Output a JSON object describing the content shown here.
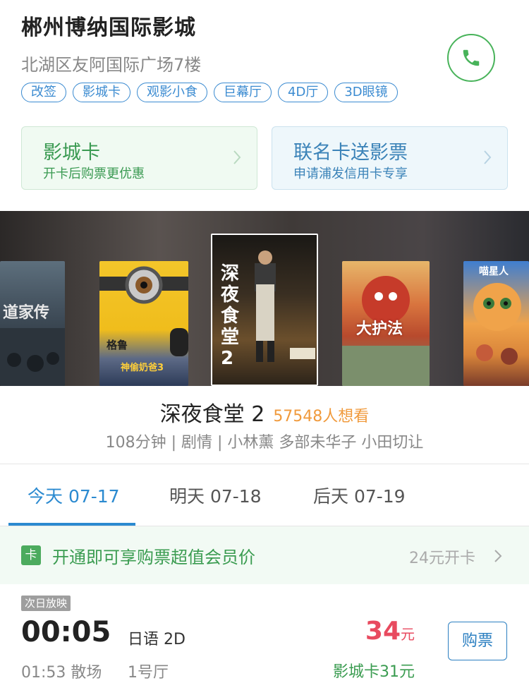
{
  "header": {
    "cinema_name": "郴州博纳国际影城",
    "address": "北湖区友阿国际广场7楼"
  },
  "tags": [
    "改签",
    "影城卡",
    "观影小食",
    "巨幕厅",
    "4D厅",
    "3D眼镜"
  ],
  "promo_cards": [
    {
      "title": "影城卡",
      "subtitle": "开卡后购票更优惠"
    },
    {
      "title": "联名卡送影票",
      "subtitle": "申请浦发信用卡专享"
    }
  ],
  "posters": [
    {
      "text": "道家传"
    },
    {
      "text": "神偷奶爸3"
    },
    {
      "text": "深夜食堂2"
    },
    {
      "text": "大护法"
    },
    {
      "text": "喵星人"
    }
  ],
  "movie": {
    "title": "深夜食堂 2",
    "wants": "57548人想看",
    "meta": "108分钟 | 剧情 | 小林薰 多部未华子 小田切让"
  },
  "date_tabs": [
    {
      "label": "今天 07-17",
      "active": true
    },
    {
      "label": "明天 07-18",
      "active": false
    },
    {
      "label": "后天 07-19",
      "active": false
    }
  ],
  "member": {
    "badge": "卡",
    "text": "开通即可享购票超值会员价",
    "price": "24元开卡"
  },
  "showtime": {
    "badge": "次日放映",
    "time": "00:05",
    "language": "日语 2D",
    "end": "01:53 散场",
    "hall": "1号厅",
    "price": "34",
    "price_unit": "元",
    "card_price": "影城卡31元",
    "buy_label": "购票"
  },
  "colors": {
    "primary_blue": "#2b8ad0",
    "green": "#3b9c51",
    "price_red": "#e84a5f",
    "wants_orange": "#f09a3c"
  }
}
